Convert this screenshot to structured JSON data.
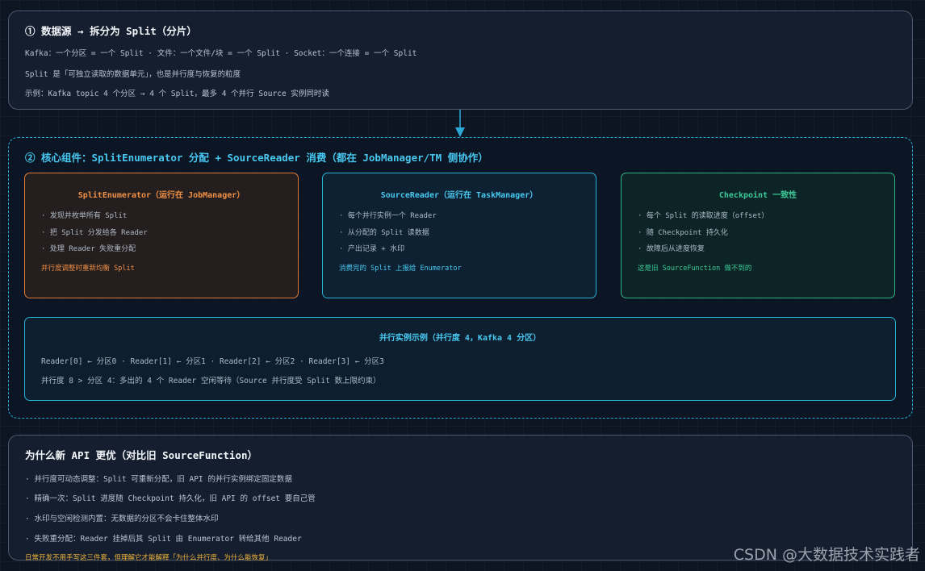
{
  "section1": {
    "title": "① 数据源 → 拆分为 Split（分片）",
    "lines": [
      "Kafka：一个分区 = 一个 Split · 文件：一个文件/块 = 一个 Split · Socket：一个连接 = 一个 Split",
      "Split 是「可独立读取的数据单元」，也是并行度与恢复的粒度",
      "示例：Kafka topic 4 个分区 → 4 个 Split，最多 4 个并行 Source 实例同时读"
    ]
  },
  "section2": {
    "title": "② 核心组件：SplitEnumerator 分配 + SourceReader 消费（都在 JobManager/TM 侧协作）",
    "cards": [
      {
        "title": "SplitEnumerator（运行在 JobManager）",
        "items": [
          "· 发现并枚举所有 Split",
          "· 把 Split 分发给各 Reader",
          "· 处理 Reader 失败重分配"
        ],
        "note": "并行度调整时重新均衡 Split"
      },
      {
        "title": "SourceReader（运行在 TaskManager）",
        "items": [
          "· 每个并行实例一个 Reader",
          "· 从分配的 Split 读数据",
          "· 产出记录 + 水印"
        ],
        "note": "消费完的 Split 上报给 Enumerator"
      },
      {
        "title": "Checkpoint 一致性",
        "items": [
          "· 每个 Split 的读取进度（offset）",
          "· 随 Checkpoint 持久化",
          "· 故障后从进度恢复"
        ],
        "note": "这是旧 SourceFunction 做不到的"
      }
    ],
    "example": {
      "title": "并行实例示例（并行度 4，Kafka 4 分区）",
      "lines": [
        "Reader[0] ← 分区0 · Reader[1] ← 分区1 · Reader[2] ← 分区2 · Reader[3] ← 分区3",
        "并行度 8 > 分区 4：多出的 4 个 Reader 空闲等待（Source 并行度受 Split 数上限约束）"
      ]
    }
  },
  "section3": {
    "title": "为什么新 API 更优（对比旧 SourceFunction）",
    "lines": [
      "· 并行度可动态调整：Split 可重新分配，旧 API 的并行实例绑定固定数据",
      "· 精确一次：Split 进度随 Checkpoint 持久化，旧 API 的 offset 要自己管",
      "· 水印与空闲检测内置：无数据的分区不会卡住整体水印",
      "· 失败重分配：Reader 挂掉后其 Split 由 Enumerator 转给其他 Reader"
    ],
    "note": "日常开发不用手写这三件套，但理解它才能解释「为什么并行度、为什么能恢复」"
  },
  "watermark": "CSDN @大数据技术实践者",
  "colors": {
    "accent_cyan": "#48c8f0",
    "accent_orange": "#f09045",
    "accent_green": "#3ec996",
    "note_amber": "#f0b43a"
  }
}
